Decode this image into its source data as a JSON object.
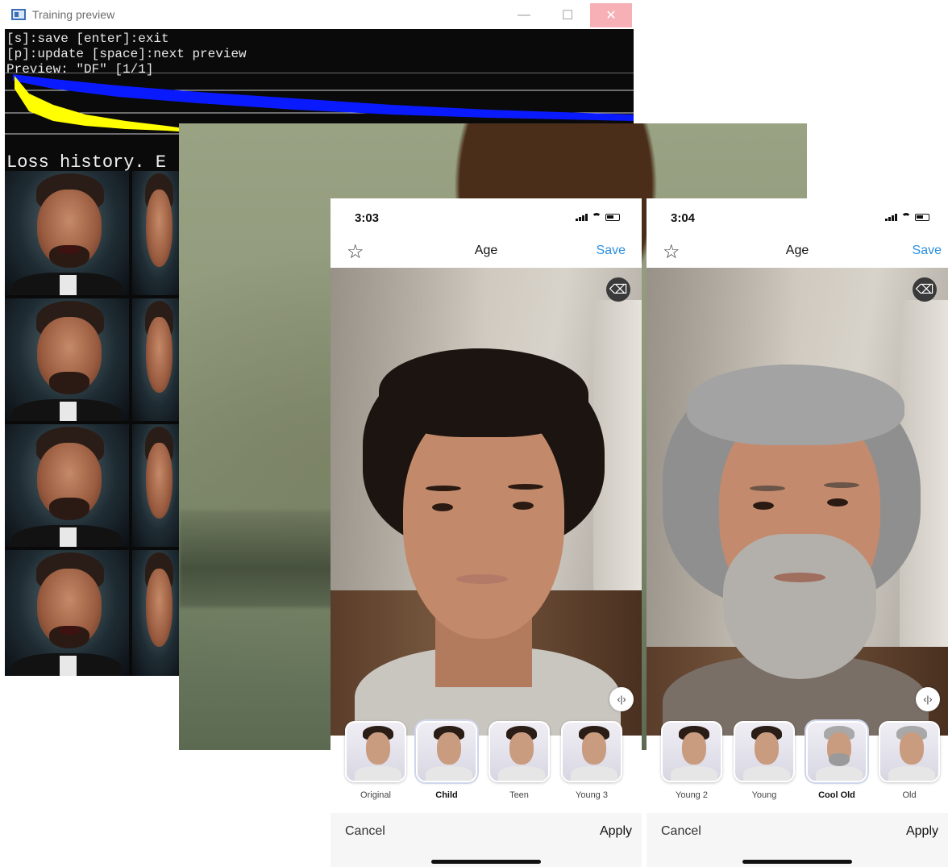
{
  "training_window": {
    "title": "Training preview",
    "controls": {
      "minimize": "—",
      "maximize": "☐",
      "close": "✕"
    },
    "console_lines": [
      "[s]:save [enter]:exit",
      "[p]:update [space]:next preview",
      "Preview: \"DF\" [1/1]"
    ],
    "loss_history_label": "Loss history. E",
    "colors": {
      "loss_series_1": "#0a1aff",
      "loss_series_2": "#ffff00"
    }
  },
  "phones": [
    {
      "time": "3:03",
      "nav": {
        "title": "Age",
        "save": "Save"
      },
      "filters": [
        {
          "label": "Original",
          "bold": false,
          "selected": false,
          "grey": false
        },
        {
          "label": "Child",
          "bold": true,
          "selected": true,
          "grey": false
        },
        {
          "label": "Teen",
          "bold": false,
          "selected": false,
          "grey": false
        },
        {
          "label": "Young 3",
          "bold": false,
          "selected": false,
          "grey": false
        }
      ],
      "cancel": "Cancel",
      "apply": "Apply"
    },
    {
      "time": "3:04",
      "nav": {
        "title": "Age",
        "save": "Save"
      },
      "filters": [
        {
          "label": "Young 2",
          "bold": false,
          "selected": false,
          "grey": false
        },
        {
          "label": "Young",
          "bold": false,
          "selected": false,
          "grey": false
        },
        {
          "label": "Cool Old",
          "bold": true,
          "selected": true,
          "grey": true
        },
        {
          "label": "Old",
          "bold": false,
          "selected": false,
          "grey": true
        }
      ],
      "cancel": "Cancel",
      "apply": "Apply"
    }
  ],
  "icons": {
    "star": "☆",
    "eraser": "⌫",
    "split": "‹|›"
  }
}
